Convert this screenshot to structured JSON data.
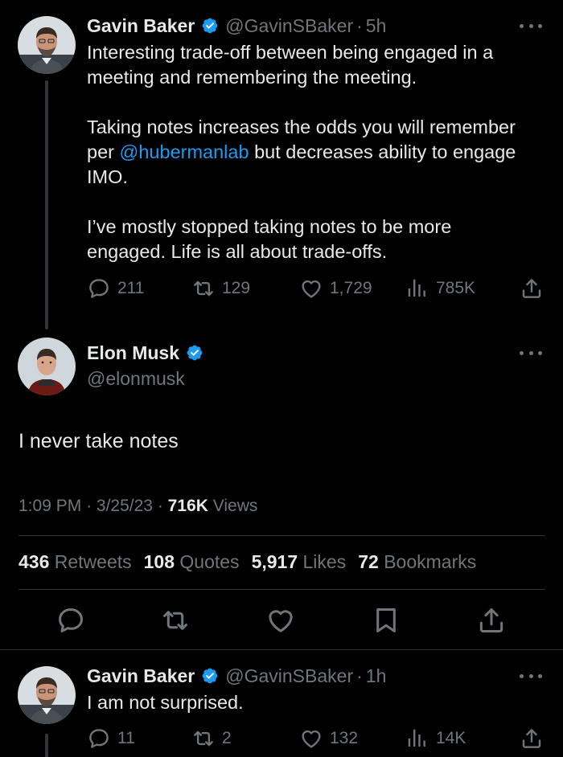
{
  "tweet1": {
    "name": "Gavin Baker",
    "handle": "@GavinSBaker",
    "separator": "·",
    "time": "5h",
    "text_part1": "Interesting trade-off between being engaged in a\nmeeting and remembering the meeting.\n\nTaking notes increases the odds you will remember\nper ",
    "mention": "@hubermanlab",
    "text_part2": " but decreases ability to engage\nIMO.\n\nI’ve mostly stopped taking notes to be more\nengaged.  Life is all about trade-offs.",
    "replies": "211",
    "retweets": "129",
    "likes": "1,729",
    "views": "785K"
  },
  "main_tweet": {
    "name": "Elon Musk",
    "handle": "@elonmusk",
    "text": "I never take notes",
    "time": "1:09 PM",
    "dot1": "·",
    "date": "3/25/23",
    "dot2": "·",
    "views_count": "716K",
    "views_label": "Views",
    "retweets_count": "436",
    "retweets_label": "Retweets",
    "quotes_count": "108",
    "quotes_label": "Quotes",
    "likes_count": "5,917",
    "likes_label": "Likes",
    "bookmarks_count": "72",
    "bookmarks_label": "Bookmarks"
  },
  "tweet3": {
    "name": "Gavin Baker",
    "handle": "@GavinSBaker",
    "separator": "·",
    "time": "1h",
    "text": "I am not surprised.",
    "replies": "11",
    "retweets": "2",
    "likes": "132",
    "views": "14K"
  },
  "icons": {
    "verified": "verified-badge-icon",
    "reply": "reply-icon",
    "retweet": "retweet-icon",
    "like": "heart-icon",
    "views": "views-icon",
    "share": "share-icon",
    "bookmark": "bookmark-icon",
    "more": "more-icon"
  },
  "colors": {
    "background": "#000000",
    "text": "#e7e9ea",
    "secondary": "#71767b",
    "accent": "#1d9bf0",
    "divider": "#2f3336"
  }
}
